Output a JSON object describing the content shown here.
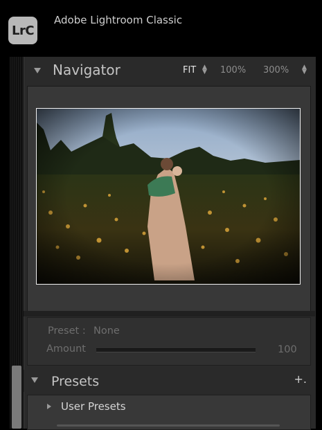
{
  "app": {
    "logo_text": "LrC",
    "title": "Adobe Lightroom Classic"
  },
  "navigator": {
    "title": "Navigator",
    "zoom_options": [
      "FIT",
      "100%",
      "300%"
    ],
    "active_zoom": "FIT"
  },
  "preset_amount": {
    "preset_label": "Preset :",
    "preset_value": "None",
    "amount_label": "Amount",
    "amount_value": "100"
  },
  "presets": {
    "title": "Presets",
    "add_symbol": "+.",
    "items": [
      {
        "label": "User Presets"
      }
    ]
  },
  "colors": {
    "panel": "#2a2a2a",
    "text": "#c4c4c4",
    "muted": "#6e6e6e"
  },
  "icons": [
    "collapse-triangle-icon",
    "expand-triangle-icon",
    "updown-arrows-icon",
    "plus-icon",
    "slider-thumb-icon"
  ]
}
